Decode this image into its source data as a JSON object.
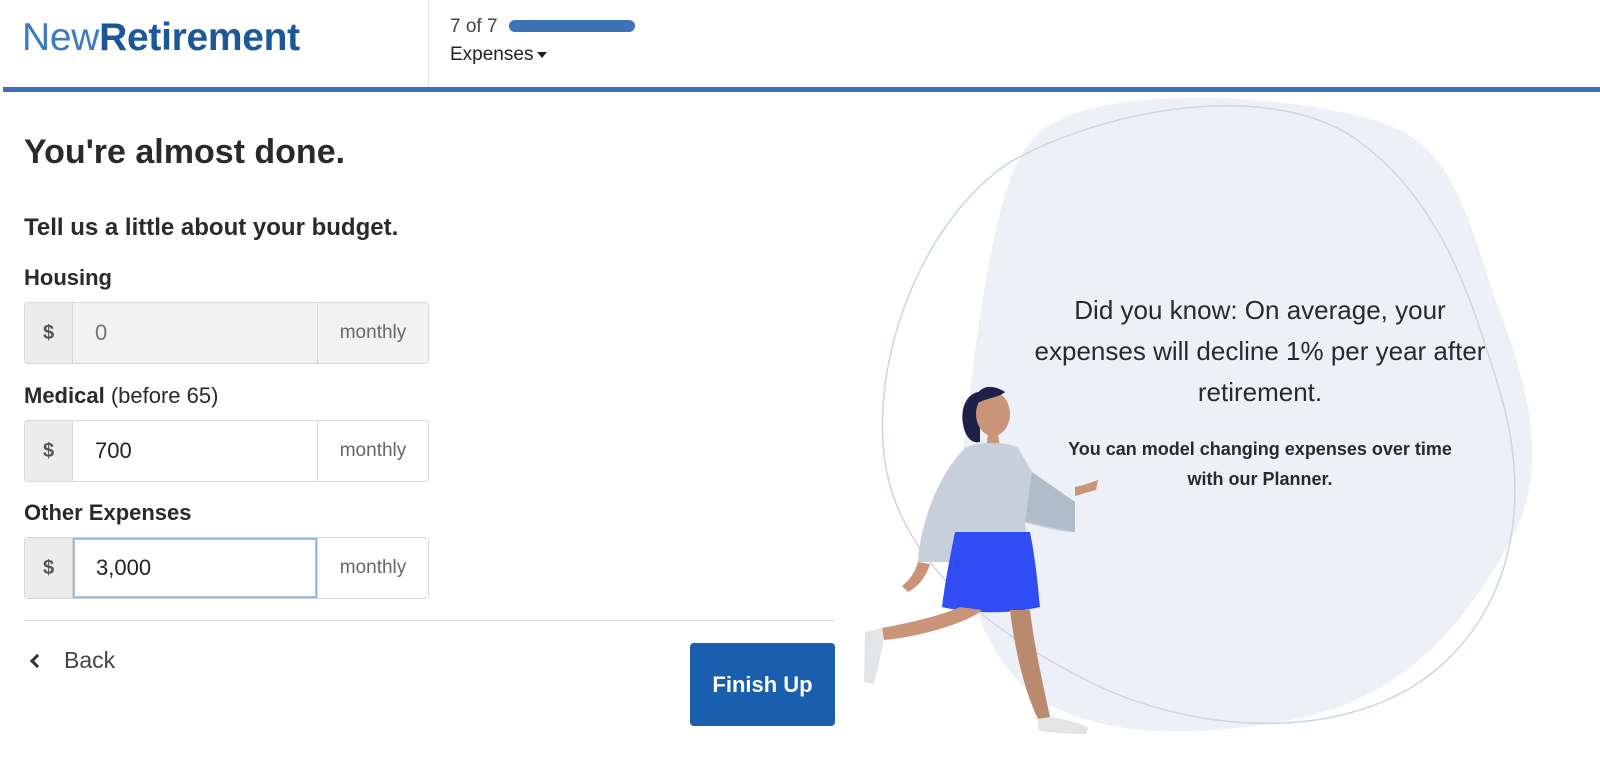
{
  "brand": {
    "name_light": "New",
    "name_bold": "Retirement"
  },
  "progress": {
    "step_text": "7 of 7",
    "value": 1.0,
    "section_label": "Expenses"
  },
  "page": {
    "title": "You're almost done.",
    "subtitle": "Tell us a little about your budget."
  },
  "fields": {
    "housing": {
      "label": "Housing",
      "prefix": "$",
      "value": "",
      "placeholder": "0",
      "suffix": "monthly",
      "disabled": true
    },
    "medical": {
      "label": "Medical",
      "qualifier": "(before 65)",
      "prefix": "$",
      "value": "700",
      "suffix": "monthly"
    },
    "other": {
      "label": "Other Expenses",
      "prefix": "$",
      "value": "3,000",
      "suffix": "monthly",
      "focused": true
    }
  },
  "actions": {
    "back_label": "Back",
    "finish_label": "Finish Up"
  },
  "tip": {
    "headline": "Did you know: On average, your expenses will decline 1% per year after retirement.",
    "body": "You can model changing expenses over time with our Planner."
  },
  "colors": {
    "brand_blue": "#1c5797",
    "accent_blue": "#3d72b4",
    "button_blue": "#1a5fad",
    "skirt_blue": "#2f4cf5",
    "blob_bg": "#edf1f7"
  },
  "icons": {
    "dropdown": "caret-down-icon",
    "back": "chevron-left-icon"
  }
}
